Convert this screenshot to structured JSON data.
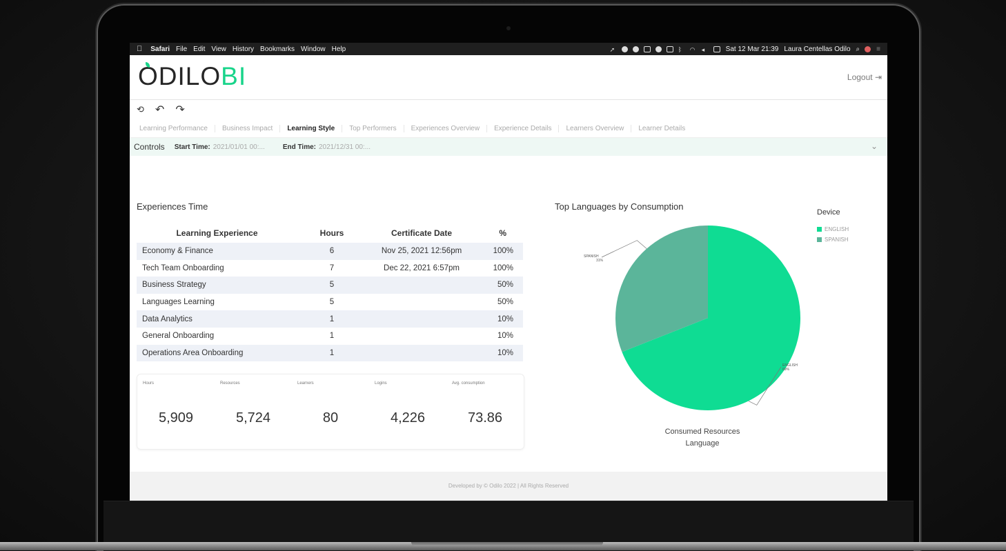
{
  "menubar": {
    "app": "Safari",
    "menus": [
      "File",
      "Edit",
      "View",
      "History",
      "Bookmarks",
      "Window",
      "Help"
    ],
    "datetime": "Sat 12 Mar  21:39",
    "user": "Laura Centellas Odilo"
  },
  "header": {
    "logo_main": "ODILO",
    "logo_accent": "BI",
    "logout": "Logout"
  },
  "toolbar": {
    "reset": "⟲",
    "undo": "↶",
    "redo": "↷"
  },
  "tabs": [
    {
      "label": "Learning Performance",
      "active": false
    },
    {
      "label": "Business Impact",
      "active": false
    },
    {
      "label": "Learning Style",
      "active": true
    },
    {
      "label": "Top Performers",
      "active": false
    },
    {
      "label": "Experiences Overview",
      "active": false
    },
    {
      "label": "Experience Details",
      "active": false
    },
    {
      "label": "Learners Overview",
      "active": false
    },
    {
      "label": "Learner Details",
      "active": false
    }
  ],
  "controls": {
    "title": "Controls",
    "start_label": "Start Time:",
    "start_value": "2021/01/01 00:...",
    "end_label": "End Time:",
    "end_value": "2021/12/31 00:..."
  },
  "experiences": {
    "title": "Experiences Time",
    "columns": [
      "Learning Experience",
      "Hours",
      "Certificate Date",
      "%"
    ],
    "rows": [
      [
        "Economy & Finance",
        "6",
        "Nov 25, 2021 12:56pm",
        "100%"
      ],
      [
        "Tech Team Onboarding",
        "7",
        "Dec 22, 2021 6:57pm",
        "100%"
      ],
      [
        "Business Strategy",
        "5",
        "",
        "50%"
      ],
      [
        "Languages Learning",
        "5",
        "",
        "50%"
      ],
      [
        "Data Analytics",
        "1",
        "",
        "10%"
      ],
      [
        "General Onboarding",
        "1",
        "",
        "10%"
      ],
      [
        "Operations Area Onboarding",
        "1",
        "",
        "10%"
      ]
    ]
  },
  "kpis": [
    {
      "label": "Hours",
      "value": "5,909"
    },
    {
      "label": "Resources",
      "value": "5,724"
    },
    {
      "label": "Learners",
      "value": "80"
    },
    {
      "label": "Logins",
      "value": "4,226"
    },
    {
      "label": "Avg. consumption",
      "value": "73.86"
    }
  ],
  "pie": {
    "title": "Top Languages by Consumption",
    "legend_title": "Device",
    "caption_line1": "Consumed Resources",
    "caption_line2": "Language",
    "slices": [
      {
        "name": "ENGLISH",
        "pct_label": "69%",
        "value": 69,
        "color": "#0fdc93"
      },
      {
        "name": "SPANISH",
        "pct_label": "31%",
        "value": 31,
        "color": "#5bb59a"
      }
    ]
  },
  "footer": "Developed by © Odilo 2022 | All Rights Reserved"
}
